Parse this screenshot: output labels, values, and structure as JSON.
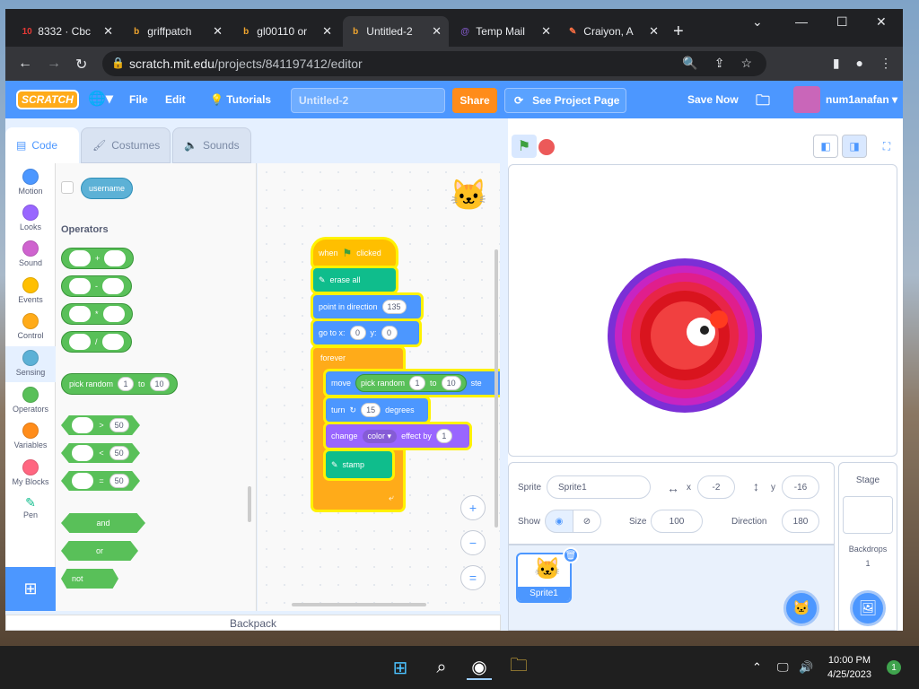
{
  "browser": {
    "tabs": [
      {
        "title": "8332 · Cbc",
        "icon": "10",
        "icon_color": "#e53935"
      },
      {
        "title": "griffpatch",
        "icon": "b",
        "icon_color": "#f2a62e"
      },
      {
        "title": "gl00110 or",
        "icon": "b",
        "icon_color": "#f2a62e"
      },
      {
        "title": "Untitled-2",
        "icon": "b",
        "icon_color": "#f2a62e"
      },
      {
        "title": "Temp Mail",
        "icon": "@",
        "icon_color": "#7e57c2"
      },
      {
        "title": "Craiyon, A",
        "icon": "✎",
        "icon_color": "#ff7043"
      }
    ],
    "close_glyph": "✕",
    "new_tab_glyph": "+",
    "url_host": "scratch.mit.edu",
    "url_path": "/projects/841197412/editor",
    "window_controls": [
      "⌄",
      "—",
      "☐",
      "✕"
    ],
    "nav": [
      "←",
      "→",
      "↻"
    ]
  },
  "menubar": {
    "logo": "SCRATCH",
    "file": "File",
    "edit": "Edit",
    "tutorials": "Tutorials",
    "project_title": "Untitled-2",
    "share": "Share",
    "see_project_page": "See Project Page",
    "save_now": "Save Now",
    "username": "num1anafan"
  },
  "editor": {
    "tabs": {
      "code": "Code",
      "costumes": "Costumes",
      "sounds": "Sounds"
    },
    "categories": [
      {
        "label": "Motion",
        "color": "#4c97ff"
      },
      {
        "label": "Looks",
        "color": "#9966ff"
      },
      {
        "label": "Sound",
        "color": "#cf63cf"
      },
      {
        "label": "Events",
        "color": "#ffbf00"
      },
      {
        "label": "Control",
        "color": "#ffab19"
      },
      {
        "label": "Sensing",
        "color": "#5cb1d6"
      },
      {
        "label": "Operators",
        "color": "#59c059"
      },
      {
        "label": "Variables",
        "color": "#ff8c1a"
      },
      {
        "label": "My Blocks",
        "color": "#ff6680"
      },
      {
        "label": "Pen",
        "color": "#0fbd8c"
      }
    ],
    "palette": {
      "username_block": "username",
      "section_title": "Operators",
      "add": "+",
      "sub": "-",
      "mul": "*",
      "div": "/",
      "pick_random": "pick random",
      "pick_from": "1",
      "pick_to_word": "to",
      "pick_to": "10",
      "gt": ">",
      "lt": "<",
      "eq": "=",
      "cmp_value": "50",
      "and": "and",
      "or": "or",
      "not": "not"
    },
    "script": {
      "hat": "when",
      "hat_suffix": "clicked",
      "erase_all": "erase all",
      "point_dir": "point in direction",
      "point_dir_val": "135",
      "goto_x": "go to x:",
      "goto_x_val": "0",
      "goto_y": "y:",
      "goto_y_val": "0",
      "forever": "forever",
      "move": "move",
      "pick_random": "pick random",
      "pick_from": "1",
      "pick_to_word": "to",
      "pick_to": "10",
      "steps": "ste",
      "turn": "turn",
      "turn_val": "15",
      "degrees": "degrees",
      "change": "change",
      "effect": "color ▾",
      "effect_by": "effect by",
      "effect_val": "1",
      "stamp": "stamp"
    },
    "zoom": {
      "in": "+",
      "out": "−",
      "reset": "="
    },
    "backpack": "Backpack"
  },
  "stage": {
    "sprite_label": "Sprite",
    "sprite_name": "Sprite1",
    "x_label": "x",
    "x_val": "-2",
    "y_label": "y",
    "y_val": "-16",
    "show_label": "Show",
    "size_label": "Size",
    "size_val": "100",
    "direction_label": "Direction",
    "direction_val": "180",
    "sprite_tile": "Sprite1",
    "stage_title": "Stage",
    "backdrops_label": "Backdrops",
    "backdrops_count": "1"
  },
  "taskbar": {
    "time": "10:00 PM",
    "date": "4/25/2023",
    "notif": "1"
  }
}
